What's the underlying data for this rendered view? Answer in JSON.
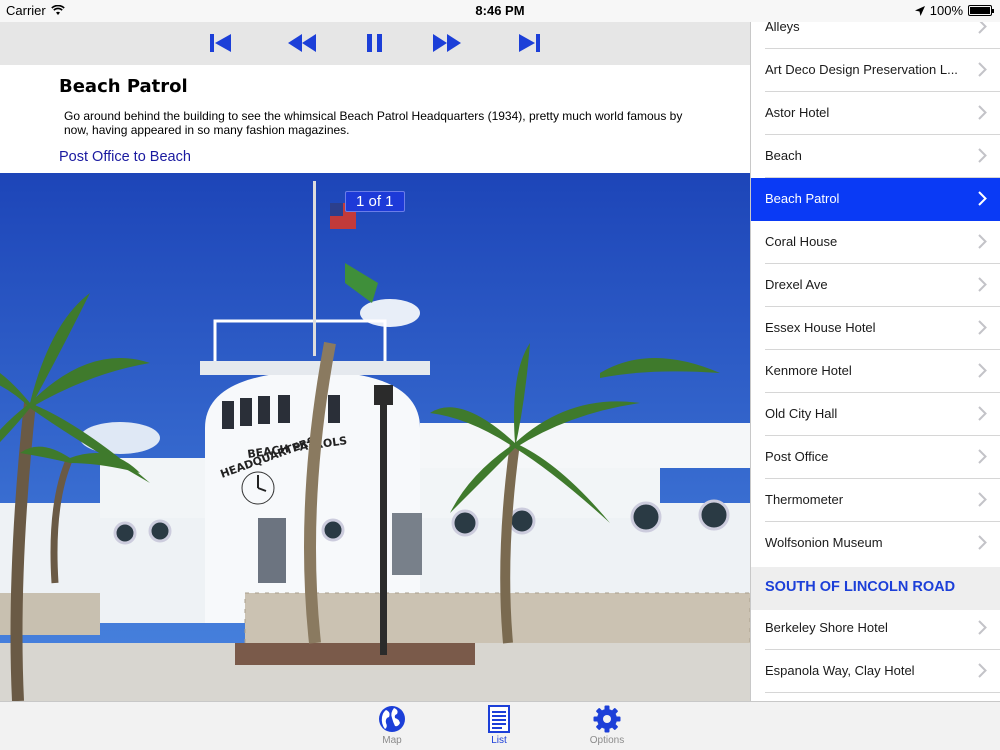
{
  "status_bar": {
    "carrier": "Carrier",
    "time": "8:46 PM",
    "battery": "100%"
  },
  "player": {
    "buttons": [
      "skip-back",
      "rewind",
      "pause",
      "fast-forward",
      "skip-forward"
    ]
  },
  "stop": {
    "title": "Beach Patrol",
    "description": "Go around behind the building to see the whimsical Beach Patrol Headquarters (1934), pretty much world famous by now, having appeared in so many fashion magazines.",
    "link": "Post Office to Beach"
  },
  "photo": {
    "counter": "1 of 1",
    "sign_line1": "BEACH PATROLS",
    "sign_line2": "HEADQUARTERS"
  },
  "list": {
    "items_top": [
      "Alleys",
      "Art Deco Design Preservation L...",
      "Astor Hotel",
      "Beach",
      "Beach Patrol",
      "Coral House",
      "Drexel Ave",
      "Essex House Hotel",
      "Kenmore Hotel",
      "Old City Hall",
      "Post Office",
      "Thermometer",
      "Wolfsonion Museum"
    ],
    "selected": "Beach Patrol",
    "section2_title": "SOUTH OF LINCOLN ROAD",
    "items_section2": [
      "Berkeley Shore Hotel",
      "Espanola Way, Clay Hotel"
    ]
  },
  "tabs": {
    "map": "Map",
    "list": "List",
    "options": "Options",
    "active": "List"
  },
  "colors": {
    "accent": "#1c3fd8",
    "selected_row": "#0a3af5",
    "link": "#1a1aa0"
  }
}
